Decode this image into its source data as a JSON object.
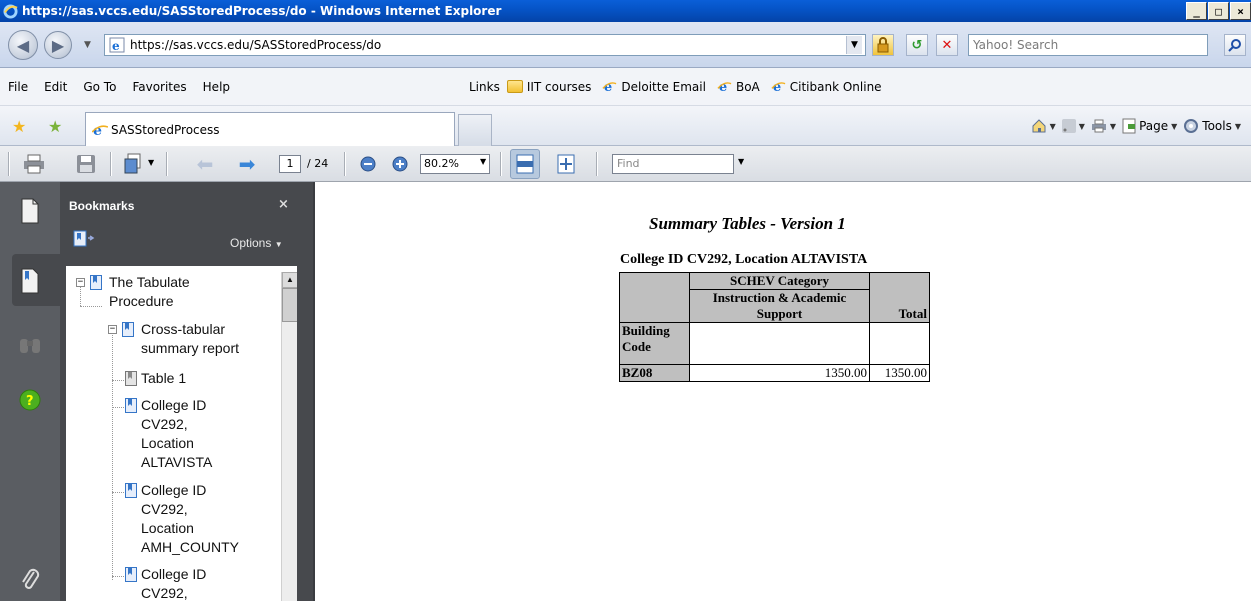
{
  "window": {
    "title": "https://sas.vccs.edu/SASStoredProcess/do - Windows Internet Explorer",
    "controls": [
      "_",
      "□",
      "×"
    ]
  },
  "address_bar": {
    "url": "https://sas.vccs.edu/SASStoredProcess/do",
    "search_placeholder": "Yahoo! Search"
  },
  "menu": [
    "File",
    "Edit",
    "Go To",
    "Favorites",
    "Help"
  ],
  "links": {
    "label": "Links",
    "items": [
      "IIT courses",
      "Deloitte Email",
      "BoA",
      "Citibank Online"
    ]
  },
  "tabs": {
    "active_label": "SASStoredProcess"
  },
  "command_bar": {
    "page_label": "Page",
    "tools_label": "Tools"
  },
  "reader": {
    "current_page": "1",
    "total_pages": "/ 24",
    "zoom": "80.2%",
    "find_placeholder": "Find"
  },
  "bookmarks": {
    "title": "Bookmarks",
    "close": "×",
    "options": "Options",
    "items": [
      {
        "line1": "The Tabulate",
        "line2": "Procedure"
      },
      {
        "line1": "Cross-tabular",
        "line2": "summary report"
      },
      {
        "line1": "Table 1"
      },
      {
        "line1": "College ID",
        "line2": "CV292,",
        "line3": "Location",
        "line4": "ALTAVISTA"
      },
      {
        "line1": "College ID",
        "line2": "CV292,",
        "line3": "Location",
        "line4": "AMH_COUNTY"
      },
      {
        "line1": "College ID",
        "line2": "CV292,"
      }
    ]
  },
  "document": {
    "title": "Summary Tables - Version 1",
    "subtitle": "College ID CV292, Location ALTAVISTA",
    "table": {
      "category_header": "SCHEV Category",
      "subcategory_header_line1": "Instruction & Academic",
      "subcategory_header_line2": "Support",
      "total_header": "Total",
      "row_header_line1": "Building",
      "row_header_line2": "Code",
      "rows": [
        {
          "code": "BZ08",
          "value": "1350.00",
          "total": "1350.00"
        }
      ]
    }
  }
}
